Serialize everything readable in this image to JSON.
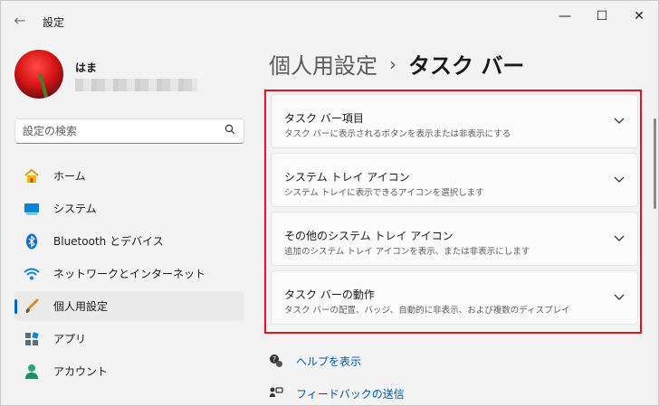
{
  "window": {
    "title": "設定",
    "back_glyph": "←",
    "minimize_glyph": "—",
    "maximize_glyph": "☐",
    "close_glyph": "✕"
  },
  "user": {
    "name": "はま"
  },
  "search": {
    "placeholder": "設定の検索"
  },
  "sidebar": {
    "items": [
      {
        "label": "ホーム",
        "icon": "home-icon"
      },
      {
        "label": "システム",
        "icon": "system-icon"
      },
      {
        "label": "Bluetooth とデバイス",
        "icon": "bluetooth-icon"
      },
      {
        "label": "ネットワークとインターネット",
        "icon": "wifi-icon"
      },
      {
        "label": "個人用設定",
        "icon": "brush-icon",
        "active": true
      },
      {
        "label": "アプリ",
        "icon": "apps-icon"
      },
      {
        "label": "アカウント",
        "icon": "account-icon"
      }
    ]
  },
  "breadcrumb": {
    "parent": "個人用設定",
    "separator": "›",
    "current": "タスク バー"
  },
  "cards": [
    {
      "title": "タスク バー項目",
      "description": "タスク バーに表示されるボタンを表示または非表示にする"
    },
    {
      "title": "システム トレイ アイコン",
      "description": "システム トレイに表示できるアイコンを選択します"
    },
    {
      "title": "その他のシステム トレイ アイコン",
      "description": "追加のシステム トレイ アイコンを表示、または非表示にします"
    },
    {
      "title": "タスク バーの動作",
      "description": "タスク バーの配置、バッジ、自動的に非表示、および複数のディスプレイ"
    }
  ],
  "links": {
    "help": "ヘルプを表示",
    "feedback": "フィードバックの送信"
  },
  "colors": {
    "accent": "#0067c0",
    "highlight": "#e8141b",
    "link": "#0058a8"
  }
}
